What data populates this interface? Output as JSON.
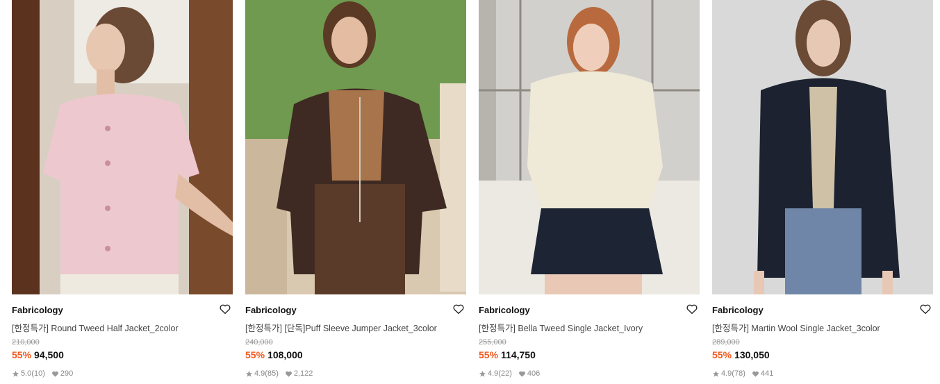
{
  "products": [
    {
      "brand": "Fabricology",
      "name": "[한정특가] Round Tweed Half Jacket_2color",
      "original_price": "210,000",
      "discount": "55%",
      "price": "94,500",
      "rating": "5.0",
      "reviews": "(10)",
      "likes": "290",
      "image_icon": "pink-tweed-jacket-photo"
    },
    {
      "brand": "Fabricology",
      "name": "[한정특가] [단독]Puff Sleeve Jumper Jacket_3color",
      "original_price": "240,000",
      "discount": "55%",
      "price": "108,000",
      "rating": "4.9",
      "reviews": "(85)",
      "likes": "2,122",
      "image_icon": "brown-jumper-jacket-photo"
    },
    {
      "brand": "Fabricology",
      "name": "[한정특가] Bella Tweed Single Jacket_Ivory",
      "original_price": "255,000",
      "discount": "55%",
      "price": "114,750",
      "rating": "4.9",
      "reviews": "(22)",
      "likes": "406",
      "image_icon": "ivory-tweed-jacket-photo"
    },
    {
      "brand": "Fabricology",
      "name": "[한정특가] Martin Wool Single Jacket_3color",
      "original_price": "289,000",
      "discount": "55%",
      "price": "130,050",
      "rating": "4.9",
      "reviews": "(78)",
      "likes": "441",
      "image_icon": "navy-wool-jacket-photo"
    }
  ],
  "colors": {
    "discount": "#f25a1f",
    "text": "#111111",
    "muted": "#888888"
  }
}
